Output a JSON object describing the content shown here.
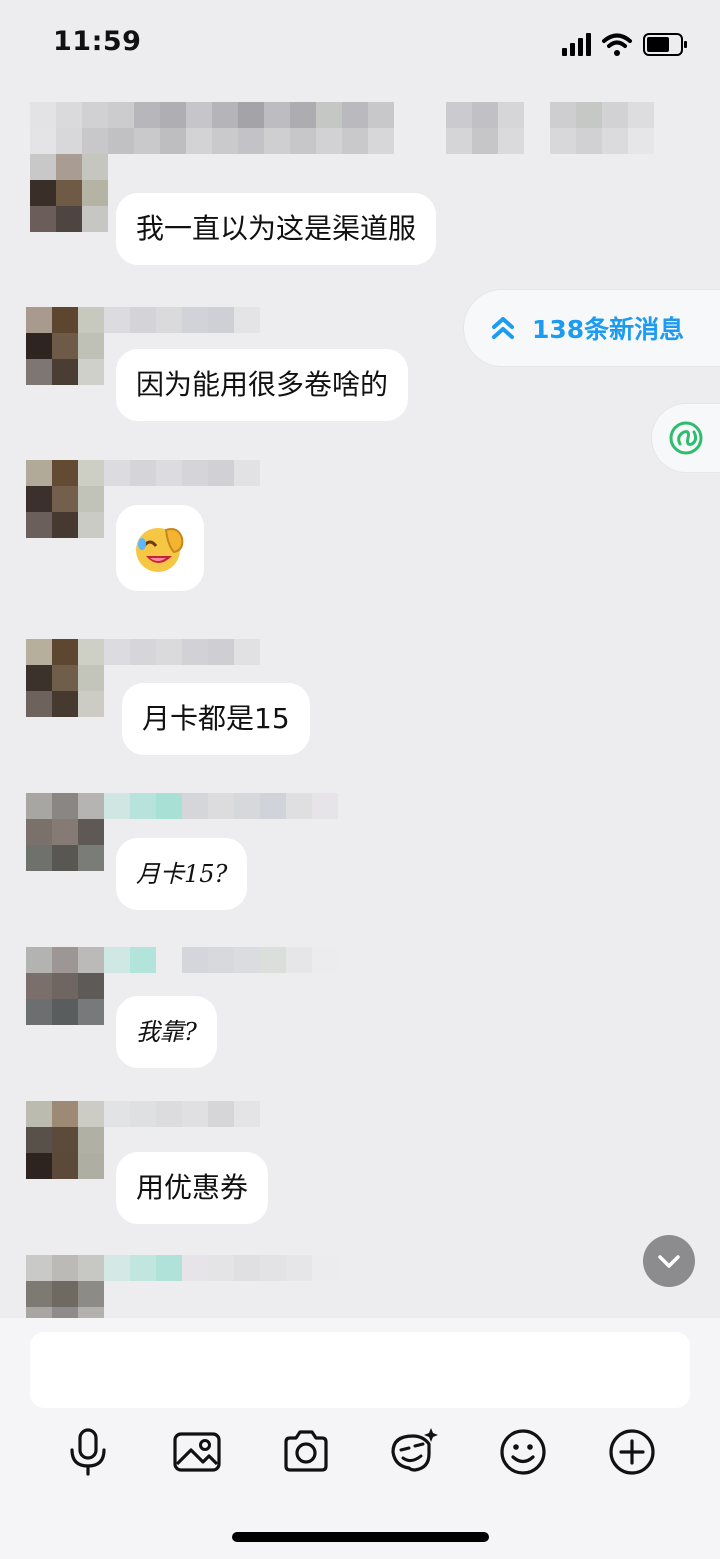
{
  "status_bar": {
    "time": "11:59"
  },
  "new_messages": {
    "label": "138条新消息"
  },
  "messages": [
    {
      "text": "我一直以为这是渠道服"
    },
    {
      "text": "因为能用很多卷啥的"
    },
    {
      "emoji": "😆"
    },
    {
      "text": "月卡都是15"
    },
    {
      "text": "月卡15?"
    },
    {
      "text": "我靠?"
    },
    {
      "text": "用优惠券"
    }
  ],
  "composer": {
    "value": ""
  },
  "toolbar": {
    "icons": [
      "microphone-icon",
      "image-icon",
      "camera-icon",
      "sticker-icon",
      "emoji-icon",
      "plus-icon"
    ]
  },
  "colors": {
    "background": "#ededf0",
    "accent": "#1d9bf0",
    "bubble": "#ffffff"
  }
}
